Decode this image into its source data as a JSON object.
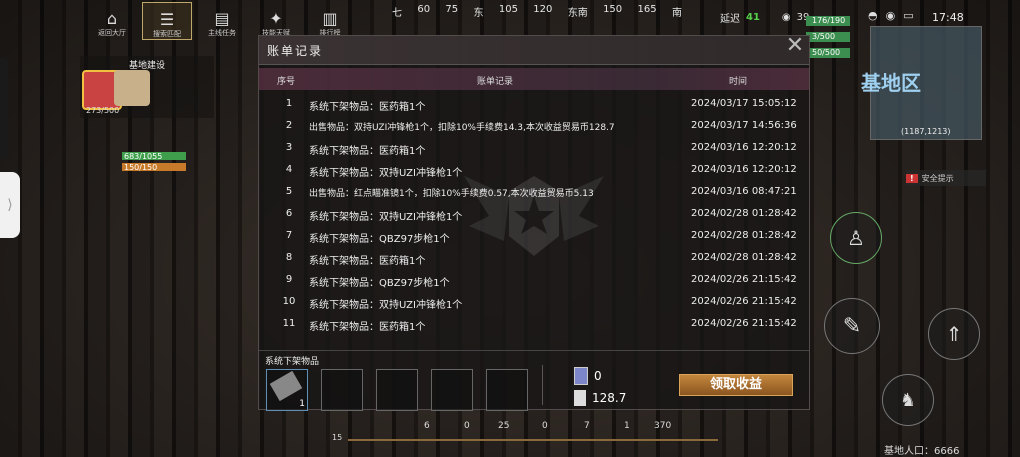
{
  "top_nav": [
    "返回大厅",
    "搜索匹配",
    "主线任务",
    "技能天赋",
    "排行榜"
  ],
  "compass": [
    "七",
    "60",
    "75",
    "东",
    "105",
    "120",
    "东南",
    "150",
    "165",
    "南"
  ],
  "status": {
    "ping_label": "延迟",
    "ping": "41",
    "players": "39",
    "clock": "17:48"
  },
  "base": {
    "title": "基地建设",
    "count": "273/500",
    "hp": "683/1055",
    "food": "150/150"
  },
  "minimap": {
    "name": "基地区",
    "coords": "(1187,1213)",
    "dist": "50"
  },
  "hp_right": [
    "176/190",
    "3/500",
    "50/500"
  ],
  "warn": "安全提示",
  "base_population": "基地人口：6666",
  "modal": {
    "title": "账单记录",
    "col_no": "序号",
    "col_desc": "账单记录",
    "col_time": "时间",
    "rows": [
      {
        "no": "1",
        "desc": "系统下架物品：医药箱1个",
        "time": "2024/03/17 15:05:12",
        "small": false
      },
      {
        "no": "2",
        "desc": "出售物品：双持UZI冲锋枪1个，扣除10%手续费14.3,本次收益贸易币128.7",
        "time": "2024/03/17 14:56:36",
        "small": true
      },
      {
        "no": "3",
        "desc": "系统下架物品：医药箱1个",
        "time": "2024/03/16 12:20:12",
        "small": false
      },
      {
        "no": "4",
        "desc": "系统下架物品：双持UZI冲锋枪1个",
        "time": "2024/03/16 12:20:12",
        "small": false
      },
      {
        "no": "5",
        "desc": "出售物品：红点瞄准镜1个，扣除10%手续费0.57,本次收益贸易币5.13",
        "time": "2024/03/16 08:47:21",
        "small": true
      },
      {
        "no": "6",
        "desc": "系统下架物品：双持UZI冲锋枪1个",
        "time": "2024/02/28 01:28:42",
        "small": false
      },
      {
        "no": "7",
        "desc": "系统下架物品：QBZ97步枪1个",
        "time": "2024/02/28 01:28:42",
        "small": false
      },
      {
        "no": "8",
        "desc": "系统下架物品：医药箱1个",
        "time": "2024/02/28 01:28:42",
        "small": false
      },
      {
        "no": "9",
        "desc": "系统下架物品：QBZ97步枪1个",
        "time": "2024/02/26 21:15:42",
        "small": false
      },
      {
        "no": "10",
        "desc": "系统下架物品：双持UZI冲锋枪1个",
        "time": "2024/02/26 21:15:42",
        "small": false
      },
      {
        "no": "11",
        "desc": "系统下架物品：医药箱1个",
        "time": "2024/02/26 21:15:42",
        "small": false
      }
    ],
    "footer_label": "系统下架物品",
    "slot_qty": "1",
    "coin_a": "0",
    "coin_b": "128.7",
    "collect_btn": "领取收益"
  },
  "bottom": {
    "level": "15",
    "ammo": [
      "6",
      "0",
      "25",
      "0",
      "7",
      "1",
      "370"
    ]
  }
}
